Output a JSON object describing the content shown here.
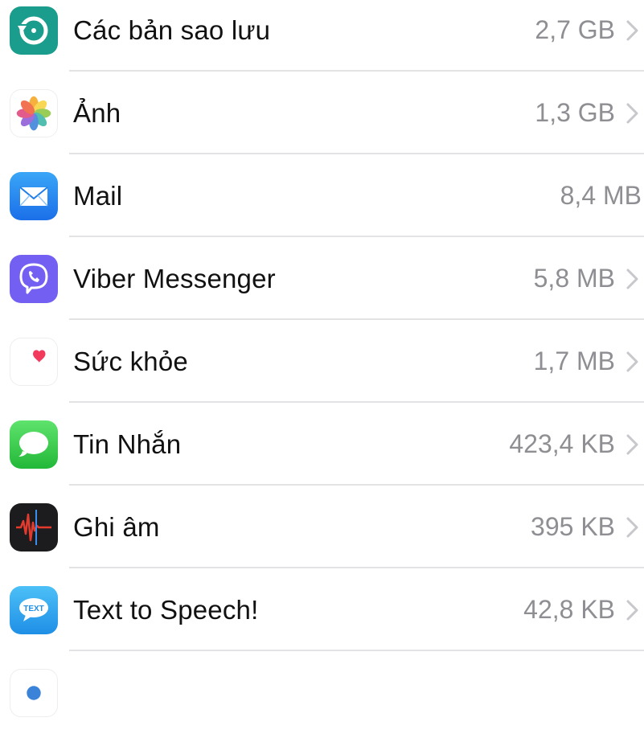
{
  "storage_list": {
    "items": [
      {
        "name": "Các bản sao lưu",
        "size": "2,7 GB",
        "icon": "backup-icon",
        "icon_color": "#1a9d8c",
        "chevron": true
      },
      {
        "name": "Ảnh",
        "size": "1,3 GB",
        "icon": "photos-icon",
        "icon_color": "#ffffff",
        "chevron": true
      },
      {
        "name": "Mail",
        "size": "8,4 MB",
        "icon": "mail-icon",
        "icon_color": "#2b8ef0",
        "chevron": false
      },
      {
        "name": "Viber Messenger",
        "size": "5,8 MB",
        "icon": "viber-icon",
        "icon_color": "#7360f2",
        "chevron": true
      },
      {
        "name": "Sức khỏe",
        "size": "1,7 MB",
        "icon": "health-icon",
        "icon_color": "#ffffff",
        "chevron": true
      },
      {
        "name": "Tin Nhắn",
        "size": "423,4 KB",
        "icon": "messages-icon",
        "icon_color": "#3ac853",
        "chevron": true
      },
      {
        "name": "Ghi âm",
        "size": "395 KB",
        "icon": "voice-memos-icon",
        "icon_color": "#1c1c1e",
        "chevron": true
      },
      {
        "name": "Text to Speech!",
        "size": "42,8 KB",
        "icon": "text-to-speech-icon",
        "icon_color": "#2fa8f0",
        "chevron": true
      }
    ]
  }
}
